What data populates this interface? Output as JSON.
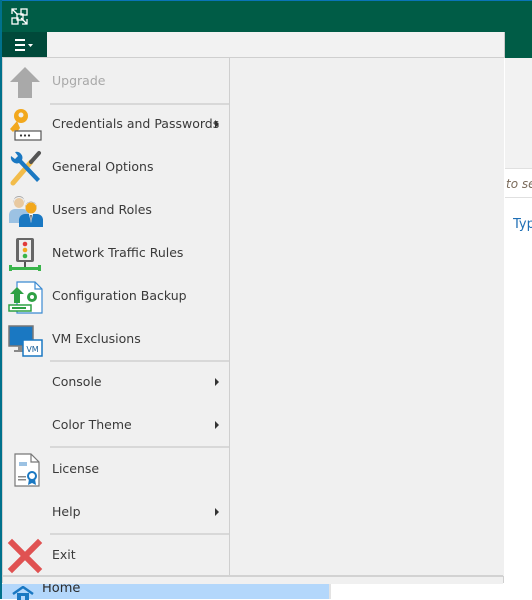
{
  "window": {
    "accent_color": "#005c46",
    "app_icon": "app-logo-icon"
  },
  "main_menu_button": {
    "icon": "hamburger-menu-icon"
  },
  "menu": {
    "items": [
      {
        "id": "upgrade",
        "label": "Upgrade",
        "icon": "upgrade-arrow-icon",
        "enabled": false,
        "submenu": false
      },
      {
        "id": "credentials",
        "label": "Credentials and Passwords",
        "icon": "key-icon",
        "enabled": true,
        "submenu": true
      },
      {
        "id": "general-options",
        "label": "General Options",
        "icon": "tools-icon",
        "enabled": true,
        "submenu": false
      },
      {
        "id": "users-roles",
        "label": "Users and Roles",
        "icon": "users-icon",
        "enabled": true,
        "submenu": false
      },
      {
        "id": "network-traffic",
        "label": "Network Traffic Rules",
        "icon": "traffic-light-icon",
        "enabled": true,
        "submenu": false
      },
      {
        "id": "config-backup",
        "label": "Configuration Backup",
        "icon": "config-backup-icon",
        "enabled": true,
        "submenu": false
      },
      {
        "id": "vm-exclusions",
        "label": "VM Exclusions",
        "icon": "vm-exclusions-icon",
        "enabled": true,
        "submenu": false
      },
      {
        "id": "console",
        "label": "Console",
        "icon": null,
        "enabled": true,
        "submenu": true
      },
      {
        "id": "color-theme",
        "label": "Color Theme",
        "icon": null,
        "enabled": true,
        "submenu": true
      },
      {
        "id": "license",
        "label": "License",
        "icon": "license-icon",
        "enabled": true,
        "submenu": false
      },
      {
        "id": "help",
        "label": "Help",
        "icon": null,
        "enabled": true,
        "submenu": true
      },
      {
        "id": "exit",
        "label": "Exit",
        "icon": "exit-x-icon",
        "enabled": true,
        "submenu": false
      }
    ]
  },
  "background": {
    "search_placeholder_partial": "to se",
    "column_header_partial": "Typ",
    "nav_home_label": "Home"
  }
}
